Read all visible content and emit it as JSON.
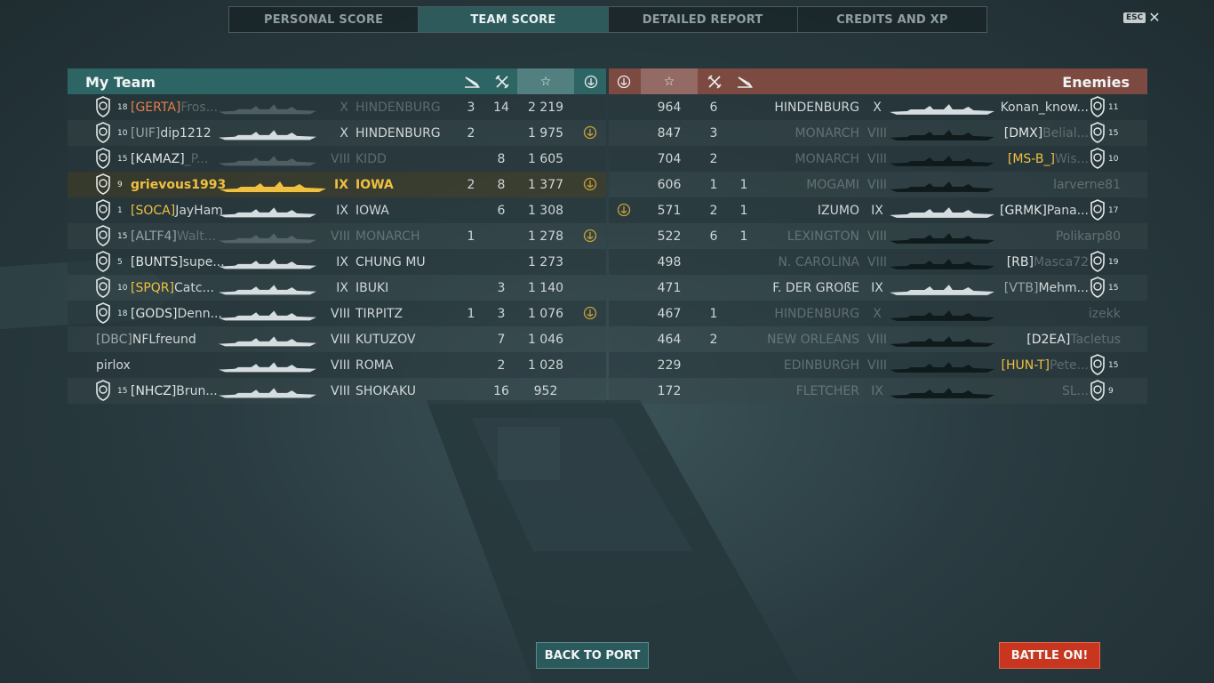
{
  "tabs": [
    "PERSONAL SCORE",
    "TEAM SCORE",
    "DETAILED REPORT",
    "CREDITS AND XP"
  ],
  "active_tab": 1,
  "esc_label": "ESC",
  "close_glyph": "✕",
  "my_team": {
    "title": "My Team",
    "header_icons": [
      "torpedo-icon",
      "aircraft-icon",
      "star-icon",
      "anchor-medal-icon"
    ],
    "players": [
      {
        "rank": "18",
        "clan": "[GERTA]",
        "clan_color": "orange",
        "name": "Fros...",
        "tier": "X",
        "ship": "HINDENBURG",
        "c1": "3",
        "c2": "14",
        "score": "2 219",
        "medal": false,
        "dim": true,
        "rank_shown": true
      },
      {
        "rank": "10",
        "clan": "[UIF]",
        "clan_color": "grey",
        "name": "dip1212",
        "tier": "X",
        "ship": "HINDENBURG",
        "c1": "2",
        "c2": "",
        "score": "1 975",
        "medal": true,
        "dim": false,
        "rank_shown": true
      },
      {
        "rank": "15",
        "clan": "[KAMAZ]",
        "clan_color": "white",
        "name": "_P...",
        "tier": "VIII",
        "ship": "KIDD",
        "c1": "",
        "c2": "8",
        "score": "1 605",
        "medal": false,
        "dim": true,
        "rank_shown": true
      },
      {
        "rank": "9",
        "clan": "",
        "clan_color": "white",
        "name": "grievous1993",
        "tier": "IX",
        "ship": "IOWA",
        "c1": "2",
        "c2": "8",
        "score": "1 377",
        "medal": true,
        "dim": false,
        "me": true,
        "rank_shown": true
      },
      {
        "rank": "1",
        "clan": "[SOCA]",
        "clan_color": "gold",
        "name": "JayHam",
        "tier": "IX",
        "ship": "IOWA",
        "c1": "",
        "c2": "6",
        "score": "1 308",
        "medal": false,
        "dim": false,
        "rank_shown": true
      },
      {
        "rank": "15",
        "clan": "[ALTF4]",
        "clan_color": "grey",
        "name": "Walt...",
        "tier": "VIII",
        "ship": "MONARCH",
        "c1": "1",
        "c2": "",
        "score": "1 278",
        "medal": true,
        "dim": true,
        "rank_shown": true
      },
      {
        "rank": "5",
        "clan": "[BUNTS]",
        "clan_color": "white",
        "name": "supe...",
        "tier": "IX",
        "ship": "CHUNG MU",
        "c1": "",
        "c2": "",
        "score": "1 273",
        "medal": false,
        "dim": false,
        "rank_shown": true
      },
      {
        "rank": "10",
        "clan": "[SPQR]",
        "clan_color": "gold",
        "name": "Catc...",
        "tier": "IX",
        "ship": "IBUKI",
        "c1": "",
        "c2": "3",
        "score": "1 140",
        "medal": false,
        "dim": false,
        "rank_shown": true
      },
      {
        "rank": "18",
        "clan": "[GODS]",
        "clan_color": "white",
        "name": "Denn...",
        "tier": "VIII",
        "ship": "TIRPITZ",
        "c1": "1",
        "c2": "3",
        "score": "1 076",
        "medal": true,
        "dim": false,
        "rank_shown": true
      },
      {
        "rank": "",
        "clan": "[DBC]",
        "clan_color": "grey",
        "name": "NFLfreund",
        "tier": "VIII",
        "ship": "KUTUZOV",
        "c1": "",
        "c2": "7",
        "score": "1 046",
        "medal": false,
        "dim": false,
        "rank_shown": false
      },
      {
        "rank": "",
        "clan": "",
        "clan_color": "white",
        "name": "pirlox",
        "tier": "VIII",
        "ship": "ROMA",
        "c1": "",
        "c2": "2",
        "score": "1 028",
        "medal": false,
        "dim": false,
        "rank_shown": false
      },
      {
        "rank": "15",
        "clan": "[NHCZ]",
        "clan_color": "white",
        "name": "Brun...",
        "tier": "VIII",
        "ship": "SHOKAKU",
        "c1": "",
        "c2": "16",
        "score": "952",
        "medal": false,
        "dim": false,
        "rank_shown": true
      }
    ]
  },
  "enemies": {
    "title": "Enemies",
    "header_icons": [
      "anchor-medal-icon",
      "star-icon",
      "aircraft-icon",
      "torpedo-icon"
    ],
    "players": [
      {
        "score": "964",
        "c2": "6",
        "c1": "",
        "ship": "HINDENBURG",
        "tier": "X",
        "clan": "",
        "clan_color": "white",
        "name": "Konan_know...",
        "rank": "11",
        "medal": false,
        "dim_ship": false,
        "dim_name": false,
        "rank_shown": true
      },
      {
        "score": "847",
        "c2": "3",
        "c1": "",
        "ship": "MONARCH",
        "tier": "VIII",
        "clan": "[DMX]",
        "clan_color": "white",
        "name": "Belial...",
        "rank": "15",
        "medal": false,
        "dim_ship": true,
        "dim_name": true,
        "rank_shown": true
      },
      {
        "score": "704",
        "c2": "2",
        "c1": "",
        "ship": "MONARCH",
        "tier": "VIII",
        "clan": "[MS-B_]",
        "clan_color": "gold",
        "name": "Wis...",
        "rank": "10",
        "medal": false,
        "dim_ship": true,
        "dim_name": true,
        "rank_shown": true
      },
      {
        "score": "606",
        "c2": "1",
        "c1": "1",
        "ship": "MOGAMI",
        "tier": "VIII",
        "clan": "",
        "clan_color": "white",
        "name": "larverne81",
        "rank": "",
        "medal": false,
        "dim_ship": true,
        "dim_name": true,
        "rank_shown": false
      },
      {
        "score": "571",
        "c2": "2",
        "c1": "1",
        "ship": "IZUMO",
        "tier": "IX",
        "clan": "[GRMK]",
        "clan_color": "white",
        "name": "Pana...",
        "rank": "17",
        "medal": true,
        "dim_ship": false,
        "dim_name": false,
        "rank_shown": true
      },
      {
        "score": "522",
        "c2": "6",
        "c1": "1",
        "ship": "LEXINGTON",
        "tier": "VIII",
        "clan": "",
        "clan_color": "white",
        "name": "Polikarp80",
        "rank": "",
        "medal": false,
        "dim_ship": true,
        "dim_name": true,
        "rank_shown": false
      },
      {
        "score": "498",
        "c2": "",
        "c1": "",
        "ship": "N. CAROLINA",
        "tier": "VIII",
        "clan": "[RB]",
        "clan_color": "white",
        "name": "Masca72",
        "rank": "19",
        "medal": false,
        "dim_ship": true,
        "dim_name": true,
        "rank_shown": true
      },
      {
        "score": "471",
        "c2": "",
        "c1": "",
        "ship": "F. DER GROßE",
        "tier": "IX",
        "clan": "[VTB]",
        "clan_color": "grey",
        "name": "Mehm...",
        "rank": "15",
        "medal": false,
        "dim_ship": false,
        "dim_name": false,
        "rank_shown": true
      },
      {
        "score": "467",
        "c2": "1",
        "c1": "",
        "ship": "HINDENBURG",
        "tier": "X",
        "clan": "",
        "clan_color": "white",
        "name": "izekk",
        "rank": "",
        "medal": false,
        "dim_ship": true,
        "dim_name": true,
        "rank_shown": false
      },
      {
        "score": "464",
        "c2": "2",
        "c1": "",
        "ship": "NEW ORLEANS",
        "tier": "VIII",
        "clan": "[D2EA]",
        "clan_color": "white",
        "name": "Tacletus",
        "rank": "",
        "medal": false,
        "dim_ship": true,
        "dim_name": true,
        "rank_shown": false
      },
      {
        "score": "229",
        "c2": "",
        "c1": "",
        "ship": "EDINBURGH",
        "tier": "VIII",
        "clan": "[HUN-T]",
        "clan_color": "gold",
        "name": "Pete...",
        "rank": "15",
        "medal": false,
        "dim_ship": true,
        "dim_name": true,
        "rank_shown": true
      },
      {
        "score": "172",
        "c2": "",
        "c1": "",
        "ship": "FLETCHER",
        "tier": "IX",
        "clan": "",
        "clan_color": "white",
        "name": "SL...",
        "rank": "9",
        "medal": false,
        "dim_ship": true,
        "dim_name": true,
        "rank_shown": true
      }
    ]
  },
  "buttons": {
    "back": "BACK TO PORT",
    "battle": "BATTLE ON!"
  },
  "colors": {
    "my_team_header": "#2d6464",
    "enemy_header": "#7d4a42",
    "battle_button": "#c8361f",
    "highlight_gold": "#f0c040",
    "clan_orange": "#e5804a"
  }
}
